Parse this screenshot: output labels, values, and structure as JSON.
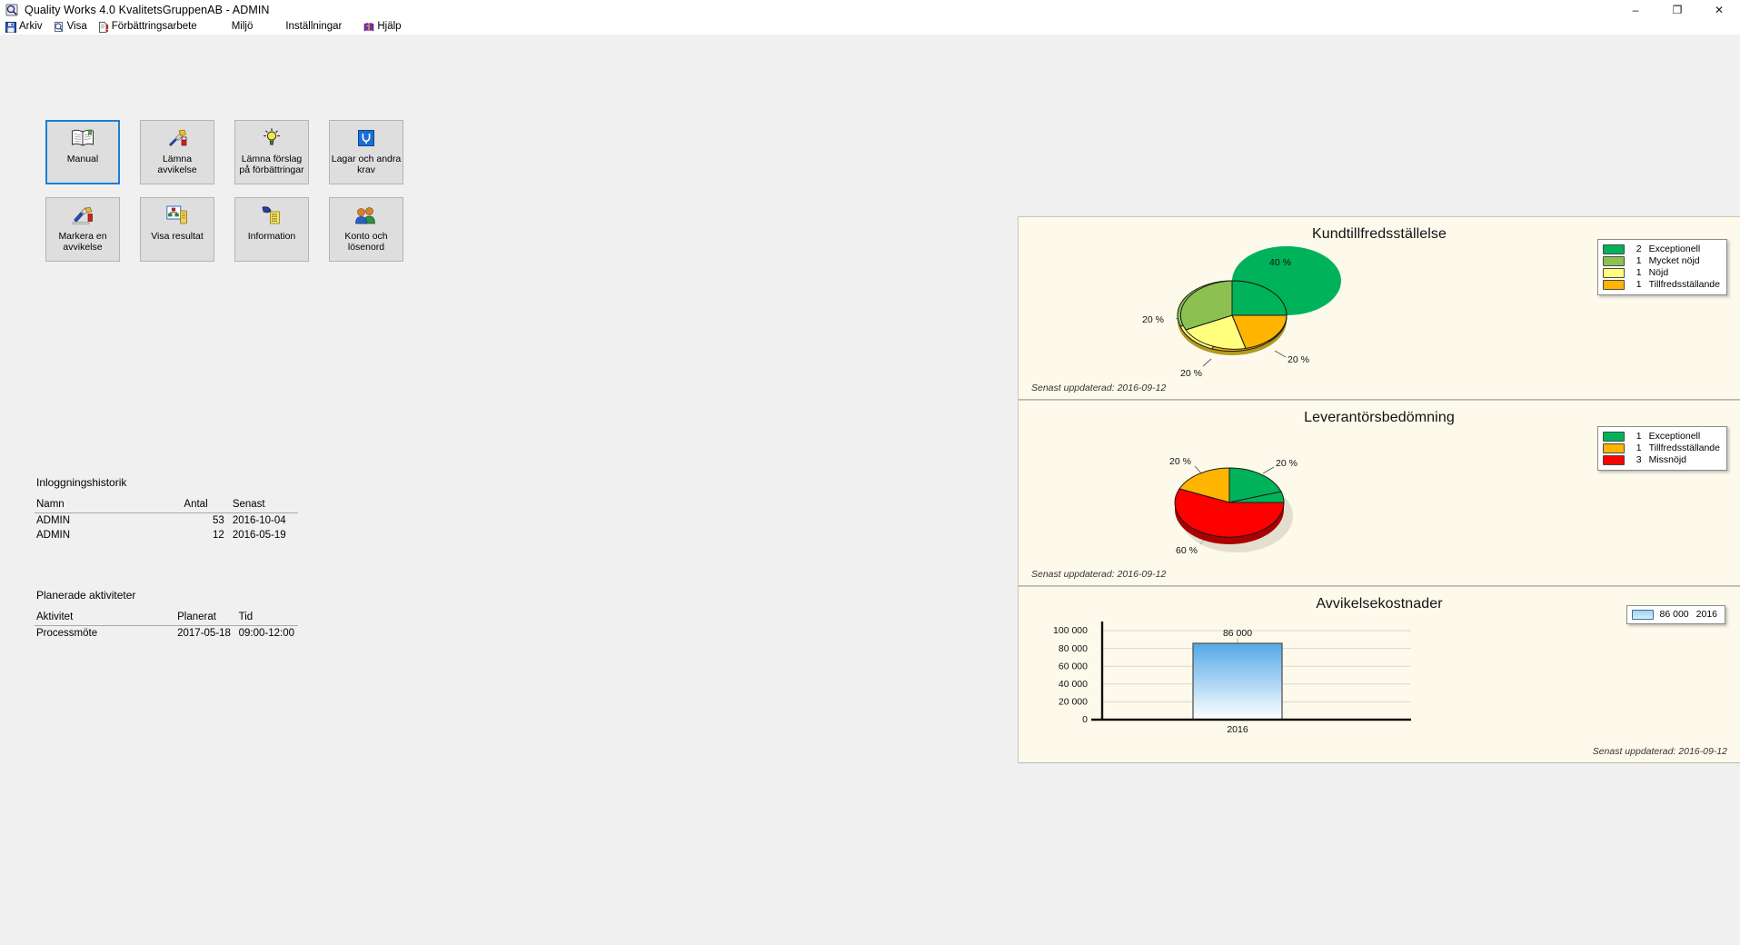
{
  "window": {
    "title": "Quality Works 4.0 KvalitetsGruppenAB - ADMIN",
    "app_icon": "app-icon",
    "controls": {
      "minimize": "–",
      "maximize": "❐",
      "close": "✕"
    }
  },
  "menubar": {
    "items": [
      {
        "label": "Arkiv",
        "icon": "save-icon"
      },
      {
        "label": "Visa",
        "icon": "preview-icon"
      },
      {
        "label": "Förbättringsarbete",
        "icon": "document-alert-icon"
      },
      {
        "label": "Miljö",
        "icon": "none"
      },
      {
        "label": "Inställningar",
        "icon": "none"
      },
      {
        "label": "Hjälp",
        "icon": "help-book-icon"
      }
    ]
  },
  "buttons": [
    {
      "label": "Manual",
      "icon": "open-book-icon",
      "selected": true
    },
    {
      "label": "Lämna\navvikelse",
      "label_line1": "Lämna",
      "label_line2": "avvikelse",
      "icon": "deviation-icon",
      "selected": false
    },
    {
      "label": "Lämna förslag\npå förbättringar",
      "label_line1": "Lämna förslag",
      "label_line2": "på förbättringar",
      "icon": "lightbulb-icon",
      "selected": false
    },
    {
      "label": "Lagar och andra\nkrav",
      "label_line1": "Lagar och andra",
      "label_line2": "krav",
      "icon": "blue-law-icon",
      "selected": false
    },
    {
      "label": "Markera en\navvikelse",
      "label_line1": "Markera en",
      "label_line2": "avvikelse",
      "icon": "mark-deviation-icon",
      "selected": false
    },
    {
      "label": "Visa resultat",
      "label_line1": "Visa resultat",
      "label_line2": "",
      "icon": "results-icon",
      "selected": false
    },
    {
      "label": "Information",
      "label_line1": "Information",
      "label_line2": "",
      "icon": "information-icon",
      "selected": false
    },
    {
      "label": "Konto och\nlösenord",
      "label_line1": "Konto och",
      "label_line2": "lösenord",
      "icon": "users-icon",
      "selected": false
    }
  ],
  "login_history": {
    "title": "Inloggningshistorik",
    "columns": [
      "Namn",
      "Antal",
      "Senast"
    ],
    "rows": [
      {
        "namn": "ADMIN",
        "antal": "53",
        "senast": "2016-10-04"
      },
      {
        "namn": "ADMIN",
        "antal": "12",
        "senast": "2016-05-19"
      }
    ]
  },
  "planned_activities": {
    "title": "Planerade aktiviteter",
    "columns": [
      "Aktivitet",
      "Planerat",
      "Tid"
    ],
    "rows": [
      {
        "aktivitet": "Processmöte",
        "planerat": "2017-05-18",
        "tid": "09:00-12:00"
      }
    ]
  },
  "panels": {
    "customer_satisfaction": {
      "title": "Kundtillfredsställelse",
      "updated": "Senast uppdaterad: 2016-09-12"
    },
    "supplier_assessment": {
      "title": "Leverantörsbedömning",
      "updated": "Senast uppdaterad: 2016-09-12"
    },
    "deviation_costs": {
      "title": "Avvikelsekostnader",
      "updated": "Senast uppdaterad: 2016-09-12"
    }
  },
  "chart_data": [
    {
      "type": "pie",
      "title": "Kundtillfredsställelse",
      "categories": [
        "Exceptionell",
        "Mycket nöjd",
        "Nöjd",
        "Tillfredsställande"
      ],
      "values": [
        2,
        1,
        1,
        1
      ],
      "percent_labels": [
        "40 %",
        "20 %",
        "20 %",
        "20 %"
      ],
      "colors": [
        "#00b259",
        "#8cc152",
        "#ffff7d",
        "#ffb400"
      ],
      "legend_position": "right",
      "legend_counts": [
        2,
        1,
        1,
        1
      ]
    },
    {
      "type": "pie",
      "title": "Leverantörsbedömning",
      "categories": [
        "Exceptionell",
        "Tillfredsställande",
        "Missnöjd"
      ],
      "values": [
        1,
        1,
        3
      ],
      "percent_labels": [
        "20 %",
        "20 %",
        "60 %"
      ],
      "colors": [
        "#00b259",
        "#ffb400",
        "#ff0000"
      ],
      "legend_position": "right",
      "legend_counts": [
        1,
        1,
        3
      ]
    },
    {
      "type": "bar",
      "title": "Avvikelsekostnader",
      "categories": [
        "2016"
      ],
      "values": [
        86000
      ],
      "data_labels": [
        "86 000"
      ],
      "xlabel": "",
      "ylabel": "",
      "ylim": [
        0,
        110000
      ],
      "yticks": [
        "0",
        "20 000",
        "40 000",
        "60 000",
        "80 000",
        "100 000"
      ],
      "legend": [
        "86 000   2016"
      ],
      "legend_value": "86 000",
      "legend_series": "2016",
      "bar_color_top": "#4ea6e8",
      "bar_color_bottom": "#ffffff",
      "grid": true,
      "legend_position": "top-right"
    }
  ]
}
